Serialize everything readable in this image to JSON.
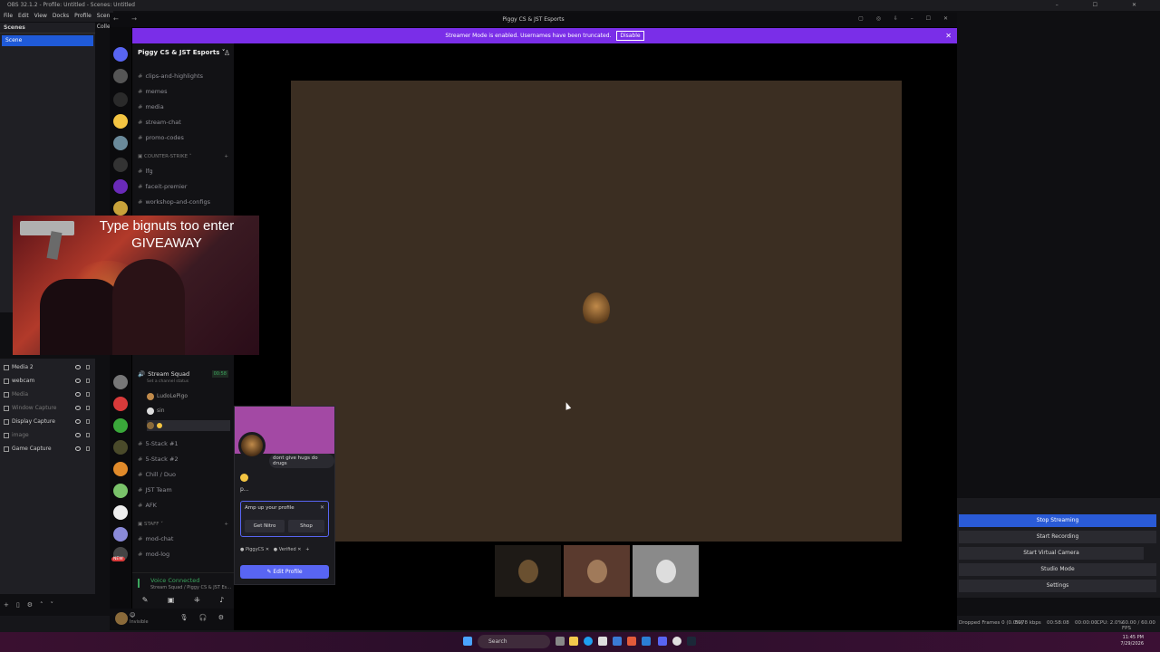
{
  "obs": {
    "title": "OBS 32.1.2 - Profile: Untitled - Scenes: Untitled",
    "menu": [
      "File",
      "Edit",
      "View",
      "Docks",
      "Profile",
      "Scene Collection"
    ],
    "scenes_header": "Scenes",
    "scene": "Scene",
    "sources": [
      {
        "name": "Media 2",
        "dim": false
      },
      {
        "name": "webcam",
        "dim": false
      },
      {
        "name": "Media",
        "dim": true
      },
      {
        "name": "Window Capture",
        "dim": true
      },
      {
        "name": "Display Capture",
        "dim": false
      },
      {
        "name": "image",
        "dim": true
      },
      {
        "name": "Game Capture",
        "dim": false
      }
    ],
    "controls": {
      "stop_streaming": "Stop Streaming",
      "start_recording": "Start Recording",
      "start_virtual_camera": "Start Virtual Camera",
      "studio_mode": "Studio Mode",
      "settings": "Settings"
    },
    "status": {
      "dropped": "Dropped Frames 0 (0.0%)",
      "bitrate": "5978 kbps",
      "live_time": "00:58:08",
      "rec_time": "00:00:00",
      "cpu": "CPU: 2.0%",
      "fps": "60.00 / 60.00 FPS"
    }
  },
  "taskbar": {
    "search": "Search",
    "time": "11:45 PM",
    "date": "7/29/2026"
  },
  "discord": {
    "title": "Piggy CS & JST Esports",
    "banner_text": "Streamer Mode is enabled. Usernames have been truncated.",
    "banner_button": "Disable",
    "guild_name": "Piggy CS & JST Esports",
    "channels_top": [
      "clips-and-highlights",
      "memes",
      "media",
      "stream-chat",
      "promo-codes"
    ],
    "category_cs": "COUNTER-STRIKE",
    "channels_cs": [
      "lfg",
      "faceit-premier",
      "workshop-and-configs"
    ],
    "voice": {
      "name": "Stream Squad",
      "timer": "00:58",
      "status_hint": "Set a channel status",
      "members": [
        "LudoLePigo",
        "sin",
        ""
      ]
    },
    "channels_voice": [
      "5-Stack #1",
      "5-Stack #2",
      "Chill / Duo",
      "JST Team",
      "AFK"
    ],
    "category_staff": "STAFF",
    "channels_staff": [
      "mod-chat",
      "mod-log"
    ],
    "new_badge": "NEW",
    "voice_connected": "Voice Connected",
    "voice_sub": "Stream Squad / Piggy CS & JST Es...",
    "user_status": "Invisible",
    "popout": {
      "bubble": "dont give hugs do drugs",
      "name": "p...",
      "amp_title": "Amp up your profile",
      "get_nitro": "Get Nitro",
      "shop": "Shop",
      "tag1": "PiggyCS",
      "tag2": "Verified",
      "edit_profile": "Edit Profile"
    }
  },
  "overlay": {
    "line1": "Type bignuts too enter",
    "line2": "GIVEAWAY"
  }
}
